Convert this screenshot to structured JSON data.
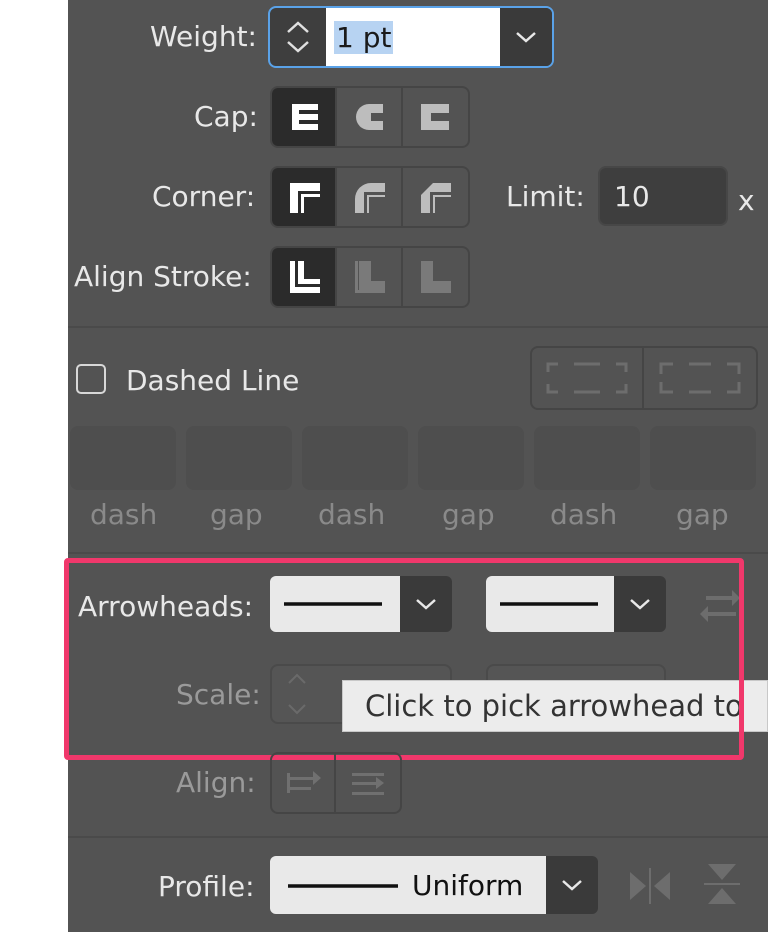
{
  "stroke": {
    "weight": {
      "label": "Weight:",
      "value": "1 pt"
    },
    "cap": {
      "label": "Cap:"
    },
    "corner": {
      "label": "Corner:",
      "limit_label": "Limit:",
      "limit_value": "10",
      "limit_suffix": "x"
    },
    "align_stroke": {
      "label": "Align Stroke:"
    },
    "dashed": {
      "label": "Dashed Line",
      "checked": false,
      "fields": [
        "dash",
        "gap",
        "dash",
        "gap",
        "dash",
        "gap"
      ]
    },
    "arrowheads": {
      "label": "Arrowheads:",
      "scale_label": "Scale:",
      "align_label": "Align:",
      "tooltip": "Click to pick arrowhead to"
    },
    "profile": {
      "label": "Profile:",
      "value": "Uniform"
    }
  },
  "colors": {
    "panel": "#535353",
    "highlight": "#f0386b",
    "field_focus": "#5aa2e8"
  }
}
